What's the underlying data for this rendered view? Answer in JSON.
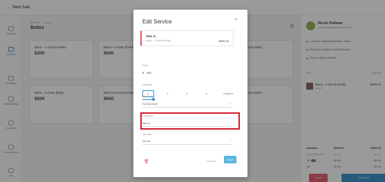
{
  "topbar": {
    "back_icon": "←",
    "title": "New Sale"
  },
  "sidebar": {
    "items": [
      {
        "label": "Meeting",
        "icon": "calendar-icon"
      },
      {
        "label": "Services",
        "icon": "services-icon"
      },
      {
        "label": "Packages",
        "icon": "package-icon"
      },
      {
        "label": "Memberships",
        "icon": "membership-icon"
      },
      {
        "label": "Vouchers",
        "icon": "voucher-icon"
      },
      {
        "label": "Commissions",
        "icon": "commission-icon"
      },
      {
        "label": "Info",
        "icon": "info-icon"
      }
    ]
  },
  "main": {
    "breadcrumb": [
      "Services",
      "Botox"
    ],
    "category_title": "Botox",
    "cards": [
      {
        "name": "Botox - 1 Area (Female)",
        "price": "$300"
      },
      {
        "name": "Botox - 2 Areas (Female)",
        "price": "$500"
      },
      {
        "name": "Botox - 1 Area (Male)",
        "price": "$300"
      },
      {
        "name": "Botox - 2 Areas (Male)",
        "price": "$500"
      },
      {
        "name": "Botox 3 Areas (Female)",
        "price": "$650"
      },
      {
        "name": "Botox 3 Areas (Male)",
        "price": "$650"
      }
    ]
  },
  "customer": {
    "name": "Nicole Pullman",
    "email": "nicole.pullman@example.com",
    "info": [
      "Location: Medical Aesthetics - Miami",
      "Booking Consultant: Robert Teacher",
      "Studio: Mayor's Medical"
    ],
    "tabs": [
      "Item",
      "Amount"
    ],
    "cart": {
      "name": "Botox - 1 Area (Female)",
      "sub": "Alex A.",
      "price": "$500.00"
    },
    "totals": [
      {
        "label": "Subtotal",
        "qty": "$500.00",
        "amount": "$500.00",
        "style": "bold"
      },
      {
        "label": "Total Discount",
        "qty": "$0.00",
        "amount": "$0.00",
        "style": "muted"
      },
      {
        "label": "Tip",
        "qty": "$0.00",
        "amount": "$0.00",
        "style": "muted"
      },
      {
        "label": "Tax",
        "qty": "$0.00",
        "amount": "$0.00",
        "style": ""
      }
    ],
    "clear_label": "Clear",
    "continue_label": "Continue"
  },
  "modal": {
    "title": "Edit Service",
    "close_icon": "×",
    "staff": {
      "name": "Alex A.",
      "service": "Botox - 1 Area (Female)",
      "price": "$500.00"
    },
    "price_label": "Price",
    "price_currency": "$",
    "price_value": "500",
    "quantity_label": "Quantity",
    "quantity_options": [
      "1",
      "2",
      "3",
      "4",
      "Custom"
    ],
    "quantity_selected": 1,
    "discount_label": "Discount",
    "discount_value": "No Discount",
    "employee_label": "Employee",
    "employee_value": "Alex A.",
    "tax_label": "Tax Rate",
    "tax_value": "No tax",
    "cancel_label": "Cancel",
    "save_label": "Save",
    "highlight_color": "#d0182b"
  }
}
